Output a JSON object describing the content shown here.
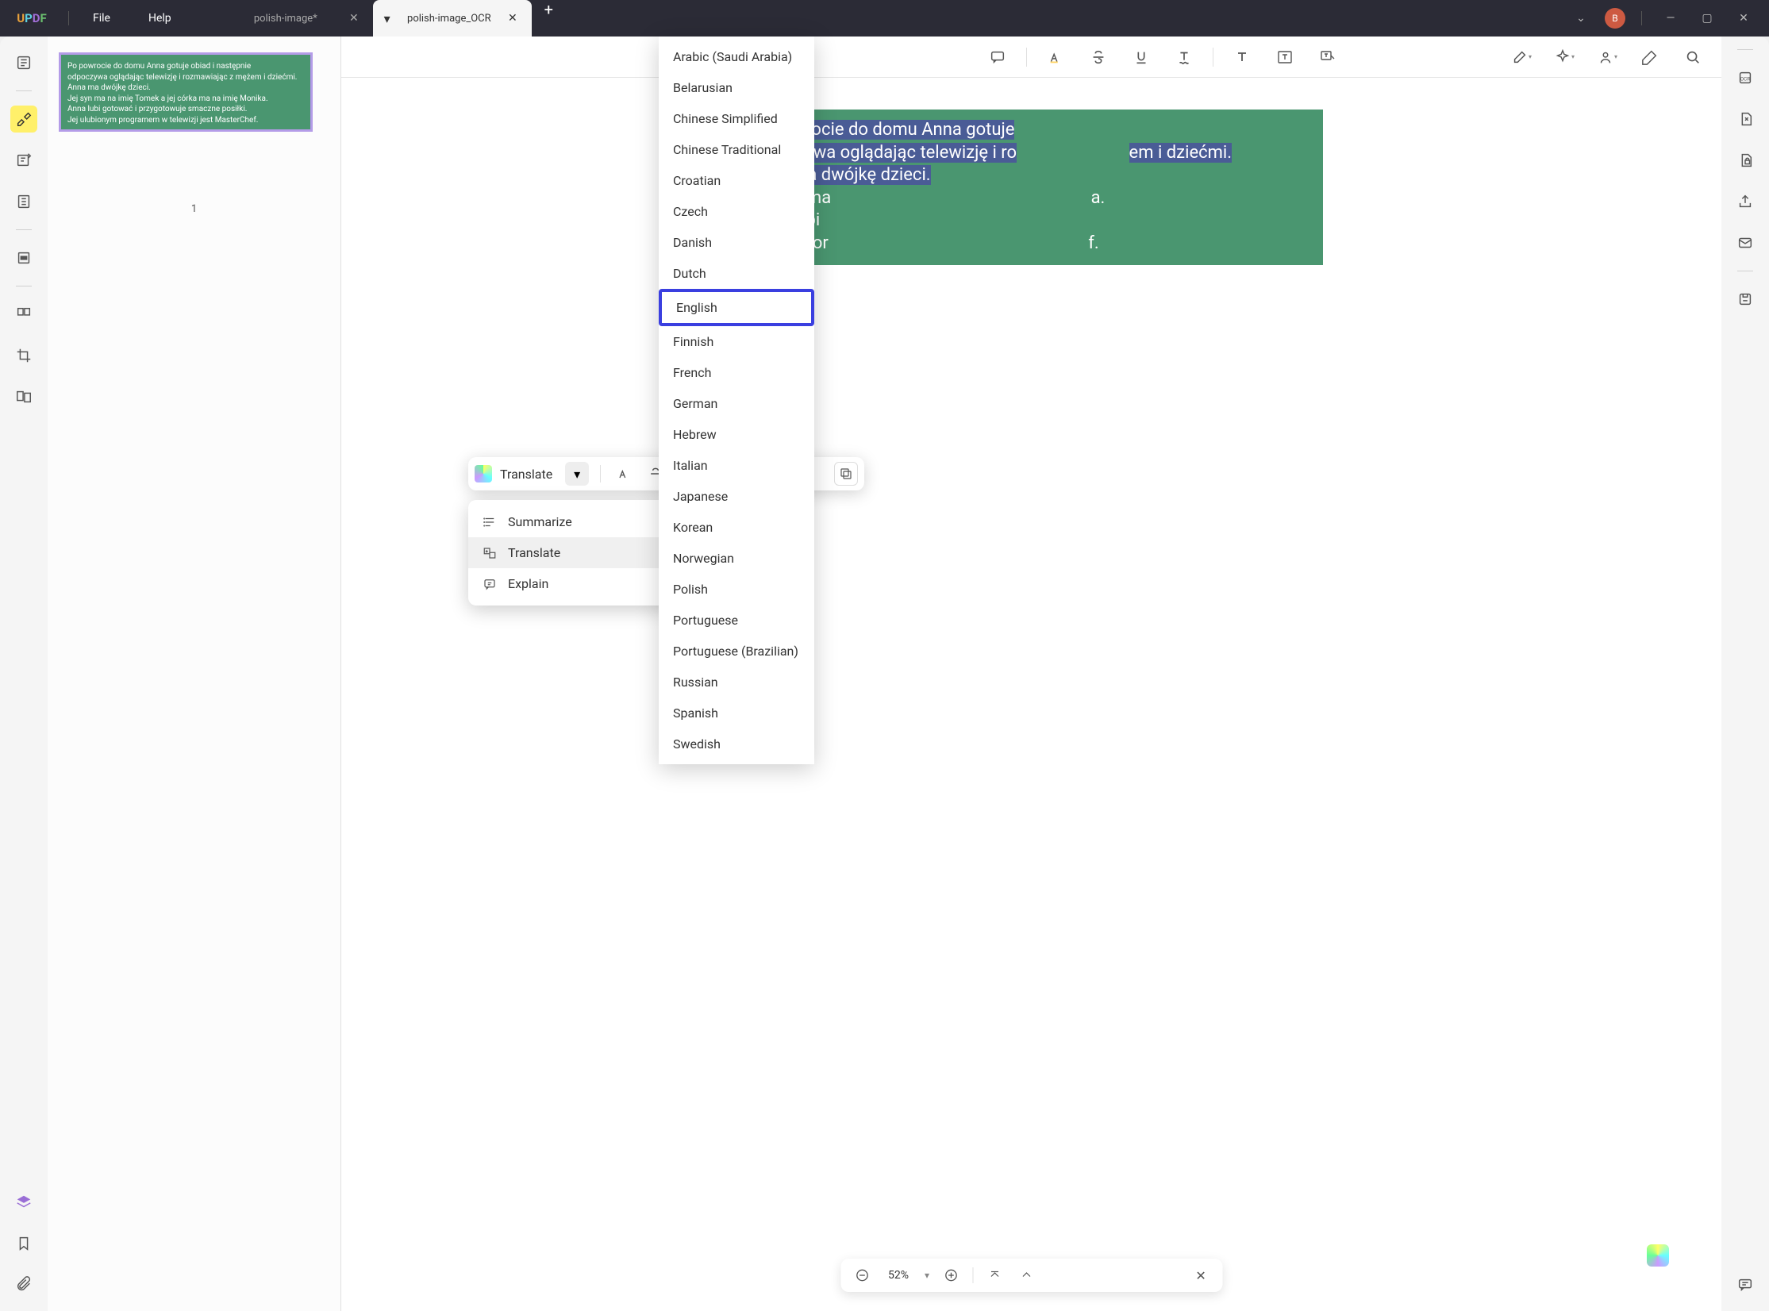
{
  "app_logo": "UPDF",
  "menu": {
    "file": "File",
    "help": "Help"
  },
  "tabs": [
    {
      "title": "polish-image*",
      "active": false,
      "modified": false
    },
    {
      "title": "polish-image_OCR",
      "active": true,
      "modified": true
    }
  ],
  "avatar_letter": "B",
  "thumbnail": {
    "lines": [
      "Po powrocie do domu Anna gotuje obiad i następnie",
      "odpoczywa oglądając telewizję i rozmawiając z mężem i dziećmi.",
      "Anna ma dwójkę dzieci.",
      "Jej syn ma na imię Tomek a jej córka ma na imię Monika.",
      "Anna lubi gotować i przygotowuje smaczne posiłki.",
      "Jej ulubionym programem w telewizji jest MasterChef."
    ],
    "page_number": "1"
  },
  "document_text": {
    "line1": "Po powrocie do domu Anna gotuje",
    "line2_a": "odpoczywa oglądając telewizję i ro",
    "line2_b": "em i dziećmi.",
    "line3": "Anna ma dwójkę dzieci.",
    "line4_a": "Jej syn ma",
    "line4_b": "a.",
    "line5": "Anna lubi",
    "line6_a": "Jej ulubior",
    "line6_b": "f."
  },
  "ai_popup": {
    "translate_label": "Translate"
  },
  "ai_dropdown": {
    "summarize": "Summarize",
    "translate": "Translate",
    "explain": "Explain"
  },
  "languages": [
    "Arabic (Saudi Arabia)",
    "Belarusian",
    "Chinese Simplified",
    "Chinese Traditional",
    "Croatian",
    "Czech",
    "Danish",
    "Dutch",
    "English",
    "Finnish",
    "French",
    "German",
    "Hebrew",
    "Italian",
    "Japanese",
    "Korean",
    "Norwegian",
    "Polish",
    "Portuguese",
    "Portuguese (Brazilian)",
    "Russian",
    "Spanish",
    "Swedish"
  ],
  "selected_language": "English",
  "zoom": {
    "value": "52%"
  }
}
